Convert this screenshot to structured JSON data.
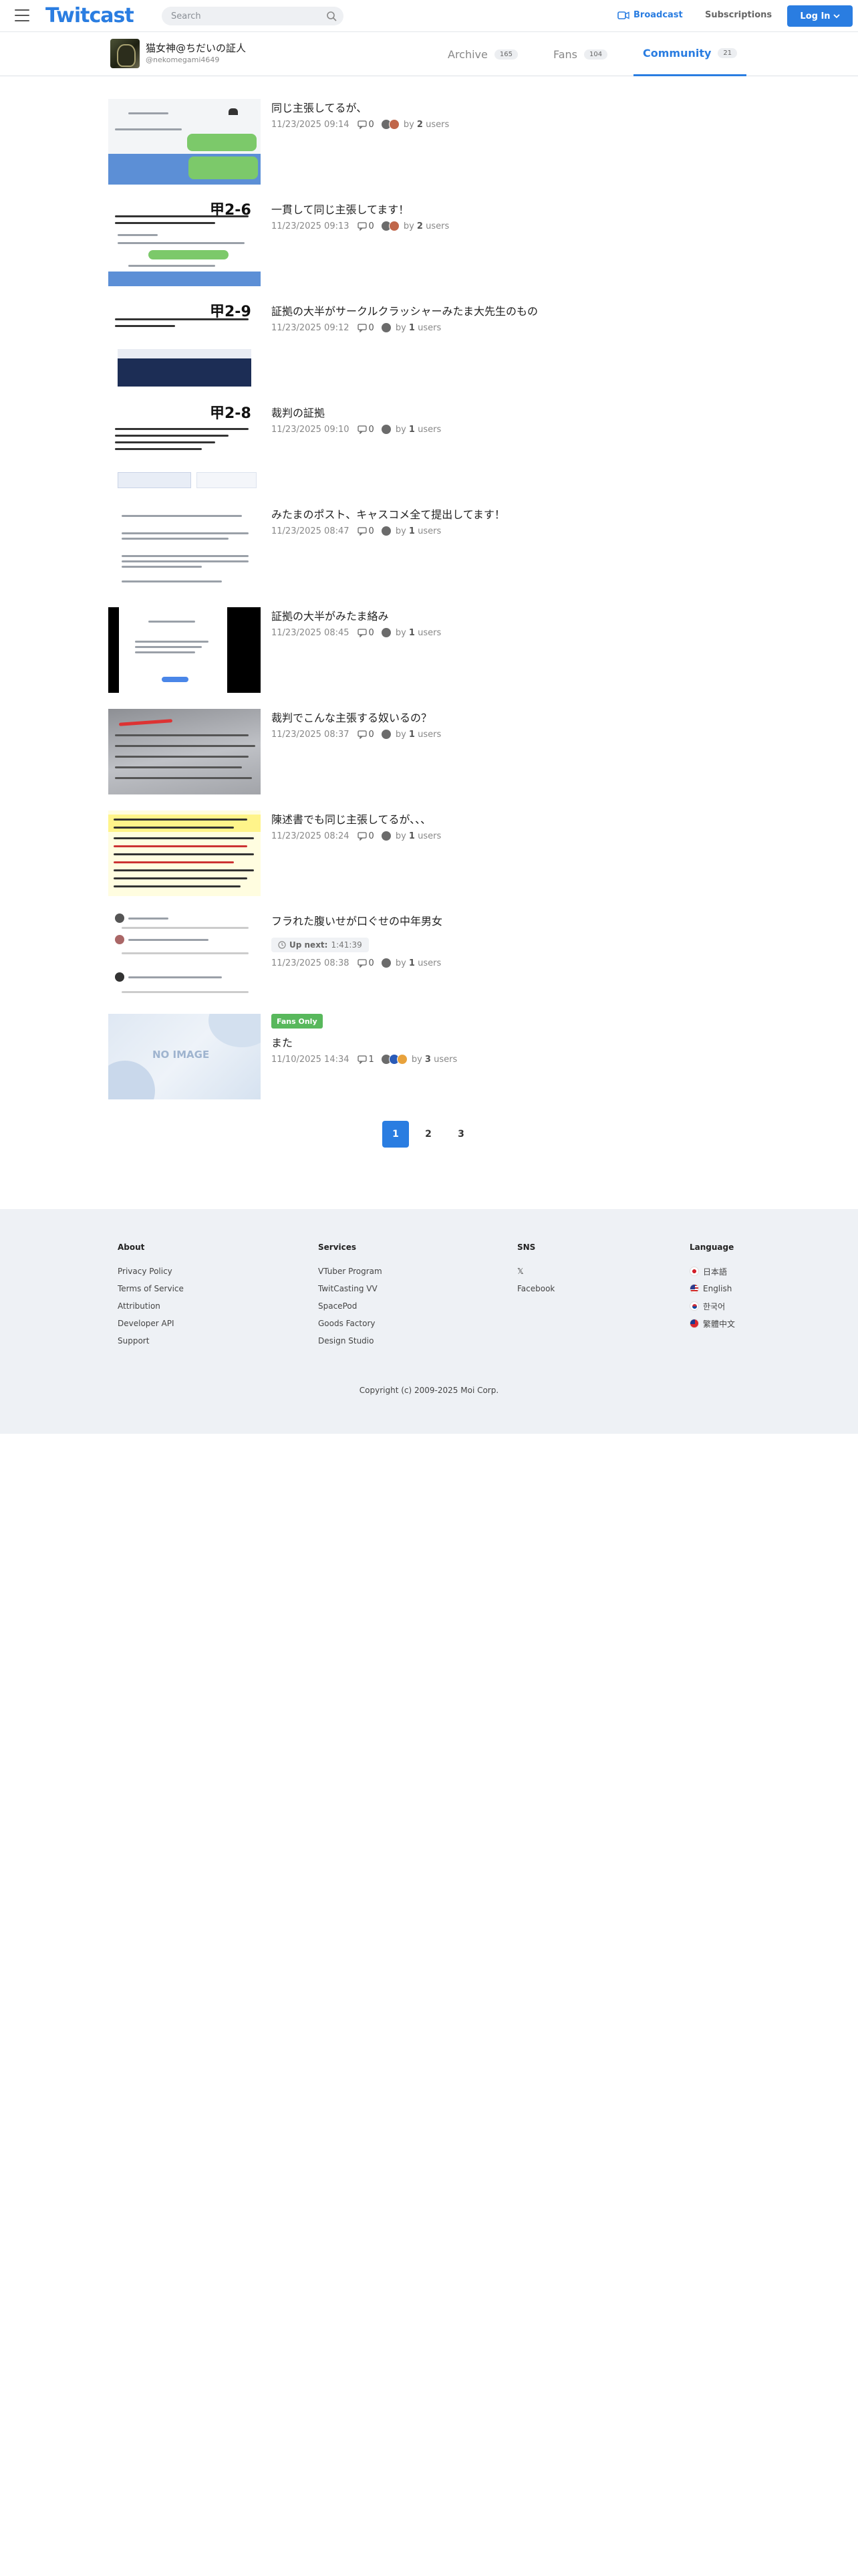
{
  "header": {
    "logo": "Twitcast",
    "search_placeholder": "Search",
    "broadcast_label": "Broadcast",
    "subscriptions_label": "Subscriptions",
    "login_label": "Log In",
    "accent_color": "#2a7de1"
  },
  "profile": {
    "name": "猫女神@ちだいの証人",
    "handle": "@nekomegami4649"
  },
  "tabs": [
    {
      "label": "Archive",
      "count": "165",
      "active": false
    },
    {
      "label": "Fans",
      "count": "104",
      "active": false
    },
    {
      "label": "Community",
      "count": "21",
      "active": true
    }
  ],
  "posts": [
    {
      "title": "同じ主張してるが、",
      "date": "11/23/2025 09:14",
      "comments": "0",
      "by_prefix": "by",
      "users_count": "2",
      "users_label": "users",
      "thumb_text": ""
    },
    {
      "title": "一貫して同じ主張してます！",
      "date": "11/23/2025 09:13",
      "comments": "0",
      "by_prefix": "by",
      "users_count": "2",
      "users_label": "users",
      "thumb_text": "甲2-6"
    },
    {
      "title": "証拠の大半がサークルクラッシャーみたま大先生のもの",
      "date": "11/23/2025 09:12",
      "comments": "0",
      "by_prefix": "by",
      "users_count": "1",
      "users_label": "users",
      "thumb_text": "甲2-9"
    },
    {
      "title": "裁判の証拠",
      "date": "11/23/2025 09:10",
      "comments": "0",
      "by_prefix": "by",
      "users_count": "1",
      "users_label": "users",
      "thumb_text": "甲2-8"
    },
    {
      "title": "みたまのポスト、キャスコメ全て提出してます！",
      "date": "11/23/2025 08:47",
      "comments": "0",
      "by_prefix": "by",
      "users_count": "1",
      "users_label": "users",
      "thumb_text": ""
    },
    {
      "title": "証拠の大半がみたま絡み",
      "date": "11/23/2025 08:45",
      "comments": "0",
      "by_prefix": "by",
      "users_count": "1",
      "users_label": "users",
      "thumb_text": ""
    },
    {
      "title": "裁判でこんな主張する奴いるの？",
      "date": "11/23/2025 08:37",
      "comments": "0",
      "by_prefix": "by",
      "users_count": "1",
      "users_label": "users",
      "thumb_text": ""
    },
    {
      "title": "陳述書でも同じ主張してるが､､､",
      "date": "11/23/2025 08:24",
      "comments": "0",
      "by_prefix": "by",
      "users_count": "1",
      "users_label": "users",
      "thumb_text": ""
    },
    {
      "title": "フラれた腹いせが口ぐせの中年男女",
      "date": "11/23/2025 08:38",
      "comments": "0",
      "by_prefix": "by",
      "users_count": "1",
      "users_label": "users",
      "thumb_text": "",
      "upnext_label": "Up next:",
      "upnext_time": "1:41:39"
    },
    {
      "title": "また",
      "date": "11/10/2025 14:34",
      "comments": "1",
      "by_prefix": "by",
      "users_count": "3",
      "users_label": "users",
      "thumb_text": "NO IMAGE",
      "badge": "Fans Only"
    }
  ],
  "pagination": [
    "1",
    "2",
    "3"
  ],
  "footer": {
    "about": {
      "heading": "About",
      "links": [
        "Privacy Policy",
        "Terms of Service",
        "Attribution",
        "Developer API",
        "Support"
      ]
    },
    "services": {
      "heading": "Services",
      "links": [
        "VTuber Program",
        "TwitCasting VV",
        "SpacePod",
        "Goods Factory",
        "Design Studio"
      ]
    },
    "sns": {
      "heading": "SNS",
      "links": [
        "𝕏",
        "Facebook"
      ]
    },
    "language": {
      "heading": "Language",
      "links": [
        "日本語",
        "English",
        "한국어",
        "繁體中文"
      ]
    },
    "copyright": "Copyright (c) 2009-2025 Moi Corp."
  }
}
